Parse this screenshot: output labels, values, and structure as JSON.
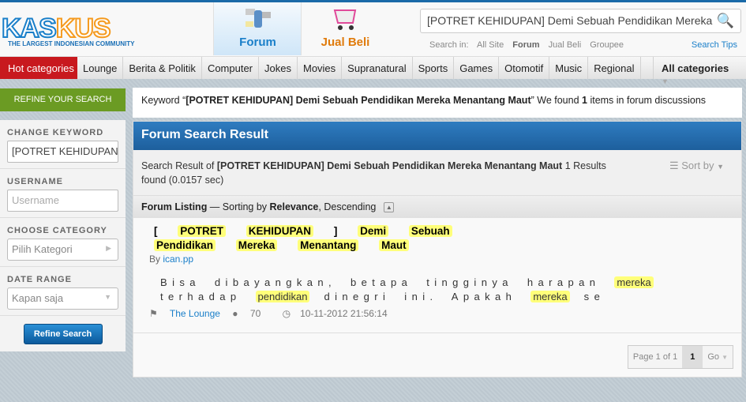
{
  "header": {
    "logo_text_a": "KAS",
    "logo_text_b": "KUS",
    "logo_tagline": "THE LARGEST INDONESIAN COMMUNITY",
    "tabs": [
      {
        "label": "Forum",
        "color": "#1a7fc9",
        "active": true
      },
      {
        "label": "Jual Beli",
        "color": "#e07b0c",
        "active": false
      }
    ],
    "search": {
      "value": "[POTRET KEHIDUPAN] Demi Sebuah Pendidikan Mereka Menantang Maut",
      "search_in_label": "Search in:",
      "scopes": [
        "All Site",
        "Forum",
        "Jual Beli",
        "Groupee"
      ],
      "active_scope": "Forum",
      "tips": "Search Tips"
    }
  },
  "nav": {
    "hot": "Hot categories",
    "items": [
      "Lounge",
      "Berita & Politik",
      "Computer",
      "Jokes",
      "Movies",
      "Supranatural",
      "Sports",
      "Games",
      "Otomotif",
      "Music",
      "Regional"
    ],
    "all": "All categories"
  },
  "sidebar": {
    "header": "REFINE YOUR SEARCH",
    "keyword_label": "CHANGE KEYWORD",
    "keyword_value": "[POTRET KEHIDUPAN] Demi Sebuah Pendidikan Mereka Menantang Maut",
    "username_label": "USERNAME",
    "username_placeholder": "Username",
    "category_label": "CHOOSE CATEGORY",
    "category_value": "Pilih Kategori",
    "date_label": "DATE RANGE",
    "date_value": "Kapan saja",
    "button": "Refine Search"
  },
  "keyword_bar": {
    "prefix": "Keyword “",
    "keyword": "[POTRET KEHIDUPAN] Demi Sebuah Pendidikan Mereka Menantang Maut",
    "mid": "” We found ",
    "count": "1",
    "suffix": " items in forum discussions"
  },
  "results": {
    "title": "Forum Search Result",
    "summary_prefix": "Search Result of ",
    "summary_keyword": "[POTRET KEHIDUPAN] Demi Sebuah Pendidikan Mereka Menantang Maut",
    "summary_suffix": " 1 Results found (0.0157 sec)",
    "sort": "Sort by",
    "listing_label": "Forum Listing",
    "listing_mid": " — Sorting by ",
    "listing_sort": "Relevance",
    "listing_order": ", Descending",
    "items": [
      {
        "title_words": [
          "[",
          "POTRET",
          "KEHIDUPAN",
          "]",
          "Demi",
          "Sebuah",
          "Pendidikan",
          "Mereka",
          "Menantang",
          "Maut"
        ],
        "by": "By ",
        "author": "ican.pp",
        "snippet": [
          "Bisa dibayangkan, betapa tingginya harapan ",
          "mereka",
          " terhadap ",
          "pendidikan",
          " dinegri ini. Apakah ",
          "mereka",
          " se"
        ],
        "category": "The Lounge",
        "replies": "70",
        "date": "10-11-2012 21:56:14"
      }
    ],
    "pager": {
      "label": "Page 1 of 1",
      "current": "1",
      "go": "Go"
    }
  },
  "colors": {
    "brand_blue": "#1a7fc9",
    "brand_orange": "#f59a1e",
    "hot_red": "#c8191e",
    "refine_green": "#6b9b23",
    "highlight": "#ffff7a"
  }
}
